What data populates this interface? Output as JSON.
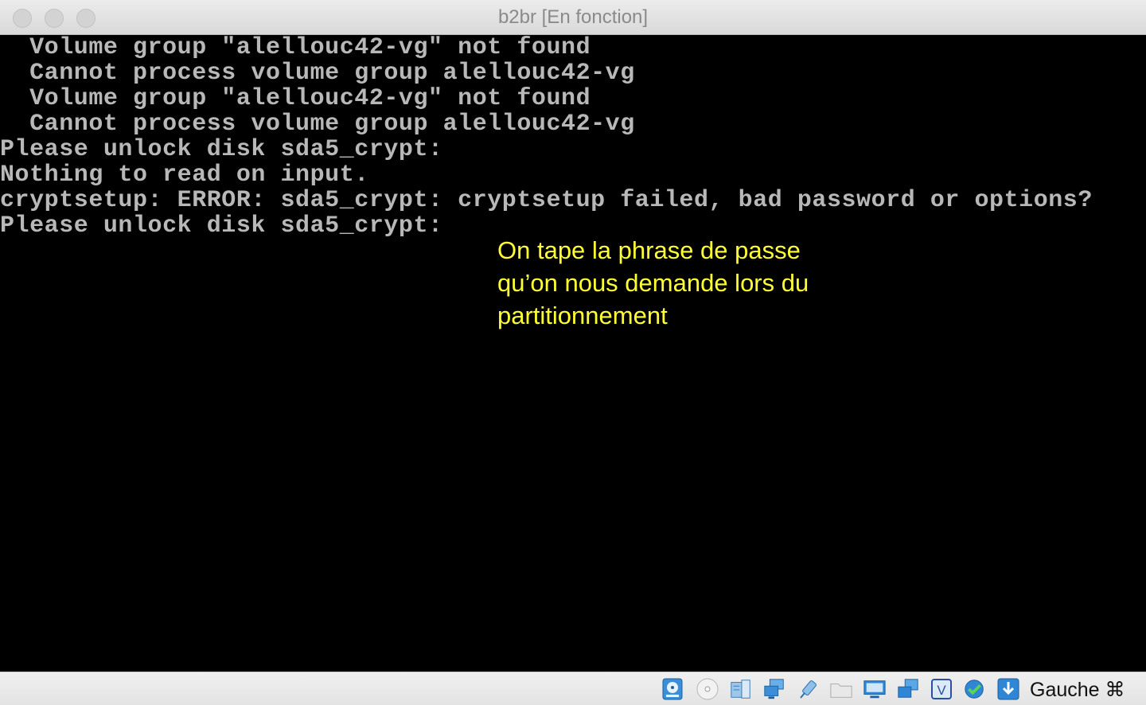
{
  "window": {
    "title": "b2br [En fonction]"
  },
  "console": {
    "lines": [
      "  Volume group \"alellouc42-vg\" not found",
      "  Cannot process volume group alellouc42-vg",
      "  Volume group \"alellouc42-vg\" not found",
      "  Cannot process volume group alellouc42-vg",
      "Please unlock disk sda5_crypt:",
      "Nothing to read on input.",
      "cryptsetup: ERROR: sda5_crypt: cryptsetup failed, bad password or options?",
      "Please unlock disk sda5_crypt:"
    ]
  },
  "annotation": {
    "lines": [
      "On tape la phrase de passe",
      "qu’on nous demande lors du",
      "partitionnement"
    ],
    "color": "#ffff33"
  },
  "statusbar": {
    "icons": [
      "hard-disk-icon",
      "optical-drive-icon",
      "audio-icon",
      "network-icon",
      "usb-icon",
      "shared-folder-icon",
      "display-icon",
      "network-activity-icon",
      "virtualization-icon",
      "guest-additions-icon",
      "download-icon"
    ],
    "host_key": "Gauche ⌘"
  }
}
